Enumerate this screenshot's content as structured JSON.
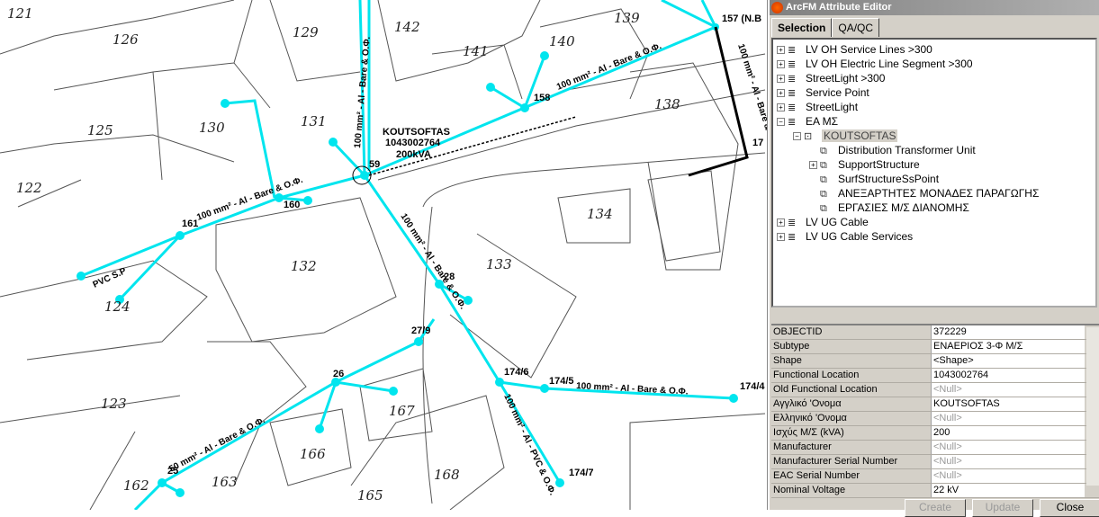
{
  "map": {
    "parcels": [
      "121",
      "126",
      "129",
      "142",
      "139",
      "140",
      "141",
      "125",
      "130",
      "131",
      "138",
      "122",
      "134",
      "132",
      "133",
      "124",
      "123",
      "167",
      "166",
      "168",
      "163",
      "162",
      "165"
    ],
    "poles": [
      "157 (N.B",
      "158",
      "59",
      "160",
      "161",
      "28",
      "27/9",
      "26",
      "174/6",
      "174/5",
      "174/4",
      "174/7",
      "25",
      "17"
    ],
    "line_labels": [
      "100 mm² - Al - Bare & O.Φ.",
      "100 mm² - Al - Bare & O.Φ.",
      "100 mm² - Al - Bare & O.Φ.",
      "100 mm² - Al - Bare & O.Φ.",
      "100 mm² - Al - Bare & O.Φ.",
      "100 mm² - Al - PVC & O.Φ.",
      "50 mm² - Al - Bare & O.Φ.",
      "100 mm² - Al - Bare & O.Φ.",
      "PVC S.P"
    ],
    "transformer": {
      "name": "KOUTSOFTAS",
      "location": "1043002764",
      "power": "200kVA"
    },
    "line_color": "#00e5ee"
  },
  "panel": {
    "title": "ArcFM Attribute Editor",
    "tabs": [
      "Selection",
      "QA/QC"
    ],
    "tree": [
      {
        "label": "LV OH Service Lines >300",
        "expanded": false
      },
      {
        "label": "LV OH Electric Line Segment >300",
        "expanded": false
      },
      {
        "label": "StreetLight >300",
        "expanded": false
      },
      {
        "label": "Service Point",
        "expanded": false
      },
      {
        "label": "StreetLight",
        "expanded": false
      },
      {
        "label": "ΕΑ ΜΣ",
        "expanded": true
      },
      {
        "label": "KOUTSOFTAS",
        "selected": true
      },
      {
        "label": "Distribution Transformer Unit"
      },
      {
        "label": "SupportStructure"
      },
      {
        "label": "SurfStructureSsPoint"
      },
      {
        "label": "ΑΝΕΞΑΡΤΗΤΕΣ ΜΟΝΑΔΕΣ ΠΑΡΑΓΩΓΗΣ"
      },
      {
        "label": "ΕΡΓΑΣΙΕΣ Μ/Σ ΔΙΑΝΟΜΗΣ"
      },
      {
        "label": "LV UG Cable",
        "expanded": false
      },
      {
        "label": "LV UG Cable Services",
        "expanded": false
      }
    ],
    "attributes": [
      {
        "k": "OBJECTID",
        "v": "372229"
      },
      {
        "k": "Subtype",
        "v": "ΕΝΑΕΡΙΟΣ 3-Φ Μ/Σ"
      },
      {
        "k": "Shape",
        "v": "<Shape>"
      },
      {
        "k": "Functional Location",
        "v": "1043002764"
      },
      {
        "k": "Old Functional Location",
        "v": "<Null>"
      },
      {
        "k": "Αγγλικό 'Ονομα",
        "v": "KOUTSOFTAS"
      },
      {
        "k": "Ελληνικό 'Ονομα",
        "v": "<Null>"
      },
      {
        "k": "Ισχύς Μ/Σ (kVA)",
        "v": "200"
      },
      {
        "k": "Manufacturer",
        "v": "<Null>"
      },
      {
        "k": "Manufacturer Serial Number",
        "v": "<Null>"
      },
      {
        "k": "EAC Serial Number",
        "v": "<Null>"
      },
      {
        "k": "Nominal Voltage",
        "v": "22 kV"
      }
    ],
    "buttons": {
      "create": "Create",
      "update": "Update",
      "close": "Close"
    }
  }
}
